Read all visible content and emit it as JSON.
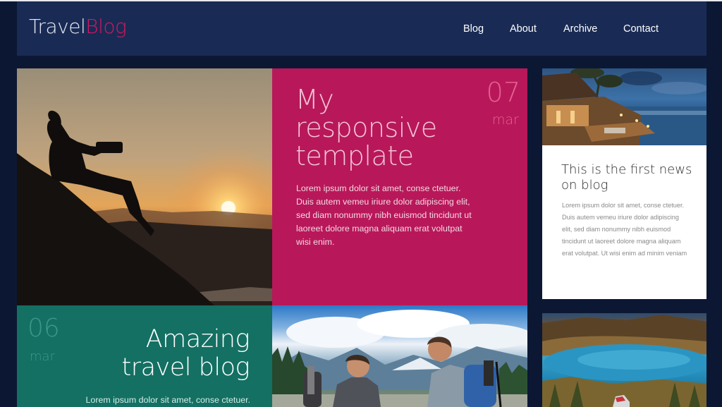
{
  "header": {
    "logo_part1": "Travel",
    "logo_part2": "Blog",
    "nav": [
      {
        "label": "Blog"
      },
      {
        "label": "About"
      },
      {
        "label": "Archive"
      },
      {
        "label": "Contact"
      }
    ]
  },
  "featured": {
    "title_line1": "My",
    "title_line2": "responsive",
    "title_line3": "template",
    "date_day": "07",
    "date_month": "mar",
    "text": "Lorem ipsum dolor sit amet, conse ctetuer. Duis autem vemeu iriure dolor adipiscing elit, sed diam nonummy nibh euismod tincidunt ut laoreet dolore magna aliquam erat volutpat wisi enim."
  },
  "news_card": {
    "title": "This is the first news on blog",
    "text": "Lorem ipsum dolor sit amet, conse ctetuer. Duis autem vemeu iriure dolor adipiscing elit, sed diam nonummy nibh euismod tincidunt ut laoreet dolore magna aliquam erat volutpat. Ut wisi enim ad minim veniam"
  },
  "second_post": {
    "date_day": "06",
    "date_month": "mar",
    "title_line1": "Amazing",
    "title_line2": "travel blog",
    "text": "Lorem ipsum dolor sit amet, conse ctetuer."
  },
  "colors": {
    "page_bg": "#0c1833",
    "header_bg": "#192b55",
    "accent_pink": "#b8185a",
    "logo_accent": "#d2195f",
    "accent_teal": "#137063"
  }
}
